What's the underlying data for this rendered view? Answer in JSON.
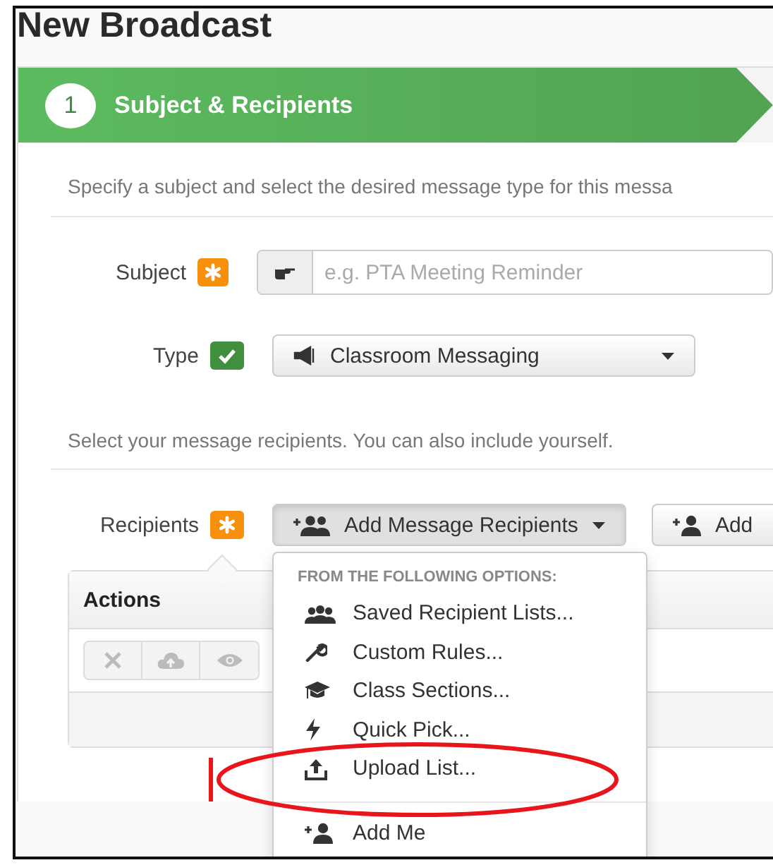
{
  "title": "New Broadcast",
  "step": {
    "number": "1",
    "label": "Subject & Recipients"
  },
  "subject_hint": "Specify a subject and select the desired message type for this messa",
  "subject": {
    "label": "Subject",
    "kind": "required",
    "placeholder": "e.g. PTA Meeting Reminder"
  },
  "type": {
    "label": "Type",
    "kind": "valid",
    "value": "Classroom Messaging"
  },
  "recipients_hint": "Select your message recipients. You can also include yourself.",
  "recipients": {
    "label": "Recipients",
    "kind": "required",
    "buttons": [
      {
        "label": "Add Message Recipients",
        "expanded": true
      },
      {
        "label": "Add",
        "expanded": false
      }
    ]
  },
  "table": {
    "columns": [
      "Actions"
    ]
  },
  "menu": {
    "header": "FROM THE FOLLOWING OPTIONS:",
    "items": [
      {
        "label": "Saved Recipient Lists..."
      },
      {
        "label": "Custom Rules..."
      },
      {
        "label": "Class Sections..."
      },
      {
        "label": "Quick Pick..."
      },
      {
        "label": "Upload List..."
      }
    ],
    "footer_items": [
      {
        "label": "Add Me"
      }
    ]
  }
}
